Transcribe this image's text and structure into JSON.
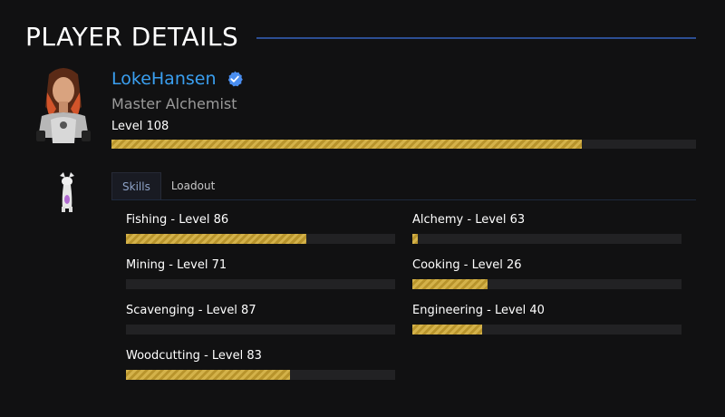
{
  "header": {
    "title": "PLAYER DETAILS"
  },
  "profile": {
    "name": "LokeHansen",
    "title": "Master Alchemist",
    "level_label": "Level 108",
    "level_progress_percent": 80.5,
    "verified_icon": "verified-check-icon"
  },
  "tabs": [
    {
      "label": "Skills",
      "active": true
    },
    {
      "label": "Loadout",
      "active": false
    }
  ],
  "skills": [
    {
      "label": "Fishing - Level 86",
      "progress_percent": 67
    },
    {
      "label": "Alchemy - Level 63",
      "progress_percent": 2
    },
    {
      "label": "Mining - Level 71",
      "progress_percent": 0
    },
    {
      "label": "Cooking - Level 26",
      "progress_percent": 28
    },
    {
      "label": "Scavenging - Level 87",
      "progress_percent": 0
    },
    {
      "label": "Engineering - Level 40",
      "progress_percent": 26
    },
    {
      "label": "Woodcutting - Level 83",
      "progress_percent": 61
    }
  ],
  "colors": {
    "accent_blue": "#3a9ff0",
    "bar_fill": "#d4b24a",
    "bar_track": "#222224",
    "header_line": "#2c4e92"
  }
}
